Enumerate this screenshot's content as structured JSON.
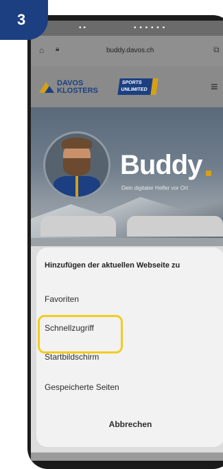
{
  "step": {
    "number": "3"
  },
  "statusbar": {
    "left": "▪ ▪",
    "right": "▪ ▪ ▪ ▪ ▪ ▪"
  },
  "browser": {
    "url": "buddy.davos.ch",
    "home_icon": "home-icon",
    "lock_icon": "lock-icon",
    "tabs_icon": "tabs-icon"
  },
  "header": {
    "brand_line1": "DAVOS",
    "brand_line2": "KLOSTERS",
    "sports_line1": "SPORTS",
    "sports_line2": "UNLIMITED",
    "menu_icon": "hamburger-menu-icon"
  },
  "hero": {
    "title": "Buddy",
    "tagline": "Dein digitaler Helfer vor Ort"
  },
  "sheet": {
    "title": "Hinzufügen der aktuellen Webseite zu",
    "options": [
      "Favoriten",
      "Schnellzugriff",
      "Startbildschirm",
      "Gespeicherte Seiten"
    ],
    "cancel": "Abbrechen"
  },
  "colors": {
    "brand_blue": "#1c3f82",
    "brand_gold": "#d4a017",
    "highlight": "#f2cc1f"
  }
}
